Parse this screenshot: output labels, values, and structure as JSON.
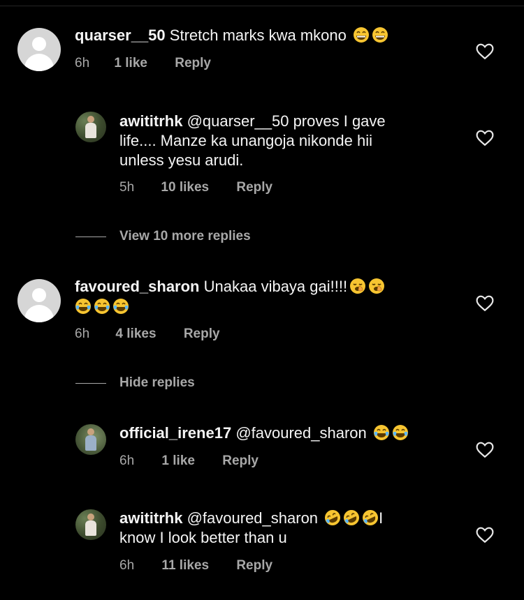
{
  "comments": [
    {
      "username": "quarser__50",
      "text": "Stretch marks kwa mkono",
      "emojis": [
        "grinning-face-emoji",
        "grinning-face-emoji"
      ],
      "time": "6h",
      "likes": "1 like",
      "reply": "Reply"
    },
    {
      "username": "awititrhk",
      "line1": "@quarser__50 proves I gave",
      "line2": "life.... Manze ka unangoja nikonde hii",
      "line3": "unless yesu arudi.",
      "time": "5h",
      "likes": "10 likes",
      "reply": "Reply"
    },
    {
      "username": "favoured_sharon",
      "text": "Unakaa vibaya gai!!!!",
      "emojis_line1": [
        "yawning-face-emoji",
        "yawning-face-emoji"
      ],
      "emojis_line2": [
        "tears-of-joy-emoji",
        "tears-of-joy-emoji",
        "tears-of-joy-emoji"
      ],
      "time": "6h",
      "likes": "4 likes",
      "reply": "Reply"
    },
    {
      "username": "official_irene17",
      "text": "@favoured_sharon",
      "emojis": [
        "tears-of-joy-emoji",
        "tears-of-joy-emoji"
      ],
      "time": "6h",
      "likes": "1 like",
      "reply": "Reply"
    },
    {
      "username": "awititrhk",
      "text": "@favoured_sharon",
      "emojis": [
        "rolling-laughing-emoji",
        "rolling-laughing-emoji",
        "rolling-laughing-emoji"
      ],
      "after_emoji": "I",
      "line2": "know I look better than u",
      "time": "6h",
      "likes": "11 likes",
      "reply": "Reply"
    }
  ],
  "view_more_replies": "View 10 more replies",
  "hide_replies": "Hide replies",
  "colors": {
    "background": "#000000",
    "text": "#f5f5f5",
    "secondary": "#a8a8a8",
    "emoji": "#f7c531"
  }
}
